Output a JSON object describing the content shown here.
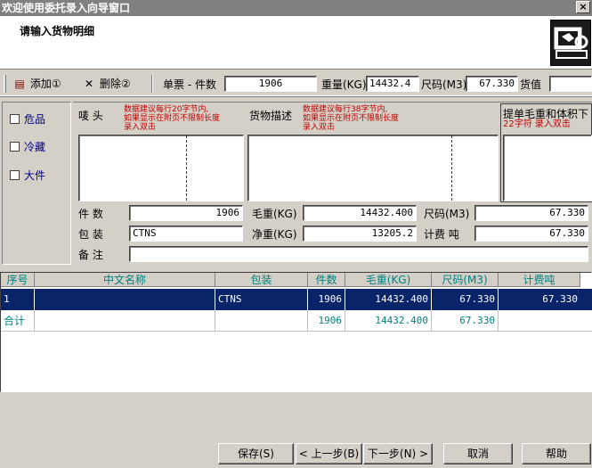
{
  "window": {
    "title": "欢迎使用委托录入向导窗口",
    "close_label": "×"
  },
  "header": {
    "title": "请输入货物明细"
  },
  "toolbar": {
    "add_label": "添加①",
    "delete_label": "删除②",
    "order_label": "单票 - 件数",
    "pieces_value": "1906",
    "weight_label": "重量(KG)",
    "weight_value": "14432.4",
    "volume_label": "尺码(M3)",
    "volume_value": "67.330",
    "goods_value_label": "货值",
    "goods_value": ""
  },
  "checkboxes": [
    "危品",
    "冷藏",
    "大件"
  ],
  "marks": {
    "label": "唛 头",
    "note1": "数据建议每行20字节内,",
    "note2": "如果显示在附页不限制长度",
    "note3": "录入双击"
  },
  "description": {
    "label": "货物描述",
    "note1": "数据建议每行38字节内,",
    "note2": "如果显示在附页不限制长度",
    "note3": "录入双击"
  },
  "bill_note": {
    "label": "提单毛重和体积下",
    "note": "22字符 录入双击"
  },
  "details": {
    "pieces_label": "件 数",
    "pieces_value": "1906",
    "gross_label": "毛重(KG)",
    "gross_value": "14432.400",
    "volume_label": "尺码(M3)",
    "volume_value": "67.330",
    "package_label": "包 装",
    "package_value": "CTNS",
    "net_label": "净重(KG)",
    "net_value": "13205.2",
    "charge_label": "计费 吨",
    "charge_value": "67.330",
    "remark_label": "备 注",
    "remark_value": ""
  },
  "grid": {
    "columns": [
      "序号",
      "中文名称",
      "包装",
      "件数",
      "毛重(KG)",
      "尺码(M3)",
      "计费吨"
    ],
    "rows": [
      [
        "1",
        "",
        "CTNS",
        "1906",
        "14432.400",
        "67.330",
        "67.330"
      ]
    ],
    "total": [
      "合计",
      "",
      "",
      "1906",
      "14432.400",
      "67.330",
      ""
    ]
  },
  "buttons": {
    "save": "保存(S)",
    "prev": "< 上一步(B)",
    "next": "下一步(N) >",
    "cancel": "取消",
    "help": "帮助"
  }
}
